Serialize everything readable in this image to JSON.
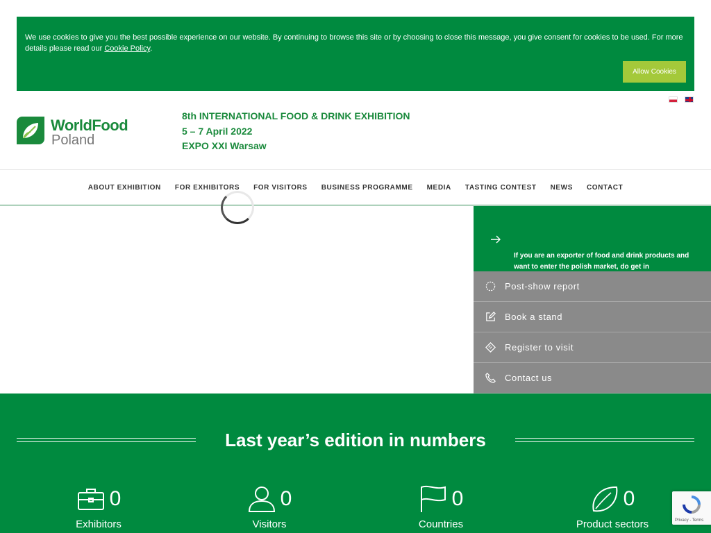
{
  "cookie": {
    "text": "We use cookies to give you the best possible experience on our website. By continuing to browse this site or by choosing to close this message, you give consent for cookies to be used. For more details please read our ",
    "link": "Cookie Policy",
    "after": ".",
    "button": "Allow Cookies"
  },
  "logo": {
    "word1": "WorldFood",
    "word2": "Poland"
  },
  "event": {
    "line1": "8th INTERNATIONAL FOOD & DRINK EXHIBITION",
    "line2": "5 – 7 April 2022",
    "line3": "EXPO XXI Warsaw"
  },
  "nav": [
    "ABOUT EXHIBITION",
    "FOR EXHIBITORS",
    "FOR VISITORS",
    "BUSINESS PROGRAMME",
    "MEDIA",
    "TASTING CONTEST",
    "NEWS",
    "CONTACT"
  ],
  "promo": {
    "text": "If you are an exporter of food and drink products and want to enter the polish market, do get in"
  },
  "quick": [
    {
      "label": "Post-show report",
      "icon": "report-icon"
    },
    {
      "label": "Book a stand",
      "icon": "edit-icon"
    },
    {
      "label": "Register to visit",
      "icon": "ticket-icon"
    },
    {
      "label": "Contact us",
      "icon": "phone-icon"
    }
  ],
  "stats": {
    "title": "Last year’s edition in numbers",
    "items": [
      {
        "value": "0",
        "label": "Exhibitors",
        "icon": "briefcase-icon"
      },
      {
        "value": "0",
        "label": "Visitors",
        "icon": "user-icon"
      },
      {
        "value": "0",
        "label": "Countries",
        "icon": "flag-icon"
      },
      {
        "value": "0",
        "label": "Product sectors",
        "icon": "leaf-icon"
      }
    ]
  },
  "recaptcha": {
    "links": "Privacy - Terms"
  },
  "colors": {
    "brand_green": "#008a3f",
    "accent_lime": "#a4c93a",
    "quick_grey": "#8a8a8a"
  }
}
